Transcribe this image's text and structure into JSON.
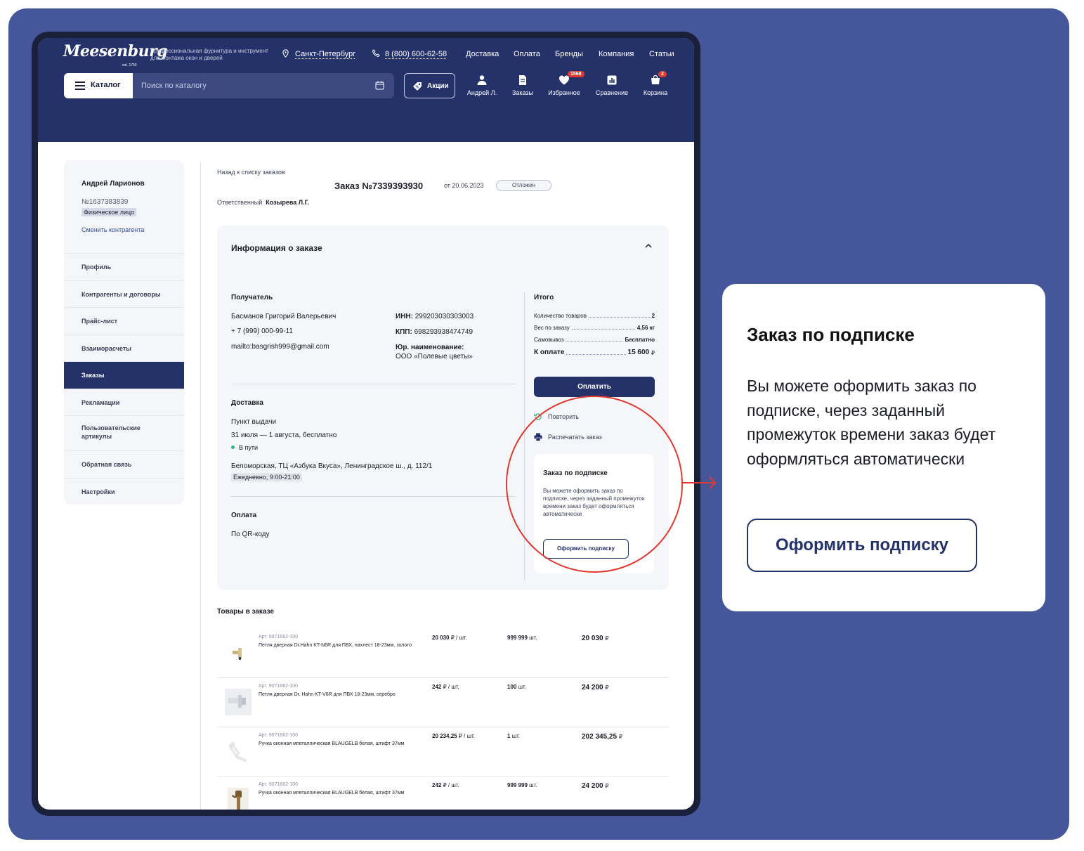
{
  "header": {
    "logo": "Meesenburg",
    "logo_est": "est. 1750",
    "tagline": "Профессиональная фурнитура и инструмент для монтажа окон и дверей",
    "city": "Санкт-Петербург",
    "phone": "8 (800) 600-62-58",
    "nav": [
      "Доставка",
      "Оплата",
      "Бренды",
      "Компания",
      "Статьи"
    ],
    "catalog_label": "Каталог",
    "search_placeholder": "Поиск по каталогу",
    "promo_label": "Акции",
    "icons": {
      "user": "Андрей Л.",
      "orders": "Заказы",
      "favorites": "Избранное",
      "favorites_badge": "1568",
      "compare": "Сравнение",
      "cart": "Корзина",
      "cart_badge": "2"
    }
  },
  "sidebar": {
    "name": "Андрей Ларионов",
    "number": "№1637383839",
    "type_tag": "Физическое лицо",
    "switch_link": "Сменить контрагента",
    "menu": [
      "Профиль",
      "Контрагенты и договоры",
      "Прайс-лист",
      "Взаиморасчеты",
      "Заказы",
      "Рекламации",
      "Пользовательские артикулы",
      "Обратная связь",
      "Настройки"
    ]
  },
  "order": {
    "back_link": "Назад к списку заказов",
    "title": "Заказ №7339393930",
    "date": "от 20.06.2023",
    "status": "Отложен",
    "responsible_label": "Ответственный",
    "responsible_name": "Козырева Л.Г."
  },
  "info": {
    "title": "Информация о заказе",
    "recipient": {
      "heading": "Получатель",
      "name": "Басманов Григорий Валерьевич",
      "phone": "+ 7 (999) 000-99-11",
      "email": "mailto:basgrish999@gmail.com",
      "inn_label": "ИНН:",
      "inn": "299203030303003",
      "kpp_label": "КПП:",
      "kpp": "698293938474749",
      "legal_label": "Юр. наименование:",
      "legal_name": "ООО «Полевые цветы»"
    },
    "delivery": {
      "heading": "Доставка",
      "method": "Пункт выдачи",
      "period": "31 июля — 1 августа, бесплатно",
      "state": "В пути",
      "address": "Беломорская, ТЦ «Азбука Вкуса», Ленинградское ш., д. 112/1",
      "hours": "Ежедневно, 9:00-21:00"
    },
    "payment": {
      "heading": "Оплата",
      "method": "По QR-коду"
    },
    "totals": {
      "heading": "Итого",
      "qty_label": "Количество товаров",
      "qty": "2",
      "weight_label": "Вес по заказу",
      "weight": "4,56 кг",
      "pickup_label": "Самовывоз",
      "pickup": "Бесплатно",
      "to_pay_label": "К оплате",
      "to_pay": "15 600",
      "currency": "₽"
    },
    "pay_button": "Оплатить",
    "repeat": "Повторить",
    "print": "Распечатать заказ",
    "subscription": {
      "heading": "Заказ по подписке",
      "text": "Вы можете оформить заказ по подписке, через заданный промежуток времени заказ будет оформляться автоматически",
      "button": "Оформить подписку"
    }
  },
  "goods": {
    "heading": "Товары в заказе",
    "items": [
      {
        "art": "Арт. 9071662-100",
        "name": "Петля дверная Dr.Hahn KT-N6R для ПВХ, нахлест 18-23мм, золото",
        "price": "20 030",
        "price_unit": "₽ / шт.",
        "qty": "999 999",
        "qty_unit": "шт.",
        "sum": "20 030",
        "sum_unit": "₽"
      },
      {
        "art": "Арт. 9071662-100",
        "name": "Петля дверная Dr. Hahn KT-V6R для ПВХ 18-23мм, серебро",
        "price": "242",
        "price_unit": "₽ / шт.",
        "qty": "100",
        "qty_unit": "шт.",
        "sum": "24 200",
        "sum_unit": "₽"
      },
      {
        "art": "Арт. 9071662-100",
        "name": "Ручка оконная мпеталлическая BLAUGELB белая, штифт 37мм",
        "price": "20 234,25",
        "price_unit": "₽ / шт.",
        "qty": "1",
        "qty_unit": "шт.",
        "sum": "202 345,25",
        "sum_unit": "₽"
      },
      {
        "art": "Арт. 9071662-100",
        "name": "Ручка оконная мпеталлическая BLAUGELB белая, штифт 37мм",
        "price": "242",
        "price_unit": "₽ / шт.",
        "qty": "999 999",
        "qty_unit": "шт.",
        "sum": "24 200",
        "sum_unit": "₽"
      }
    ]
  },
  "callout": {
    "heading": "Заказ по подписке",
    "text": "Вы можете оформить заказ по подписке, через заданный промежуток времени заказ будет оформляться автоматически",
    "button": "Оформить подписку"
  },
  "colors": {
    "brand": "#25326a",
    "background": "#46569b",
    "highlight": "#e03a30",
    "badge": "#e03a30",
    "status_ok": "#36b37e"
  }
}
